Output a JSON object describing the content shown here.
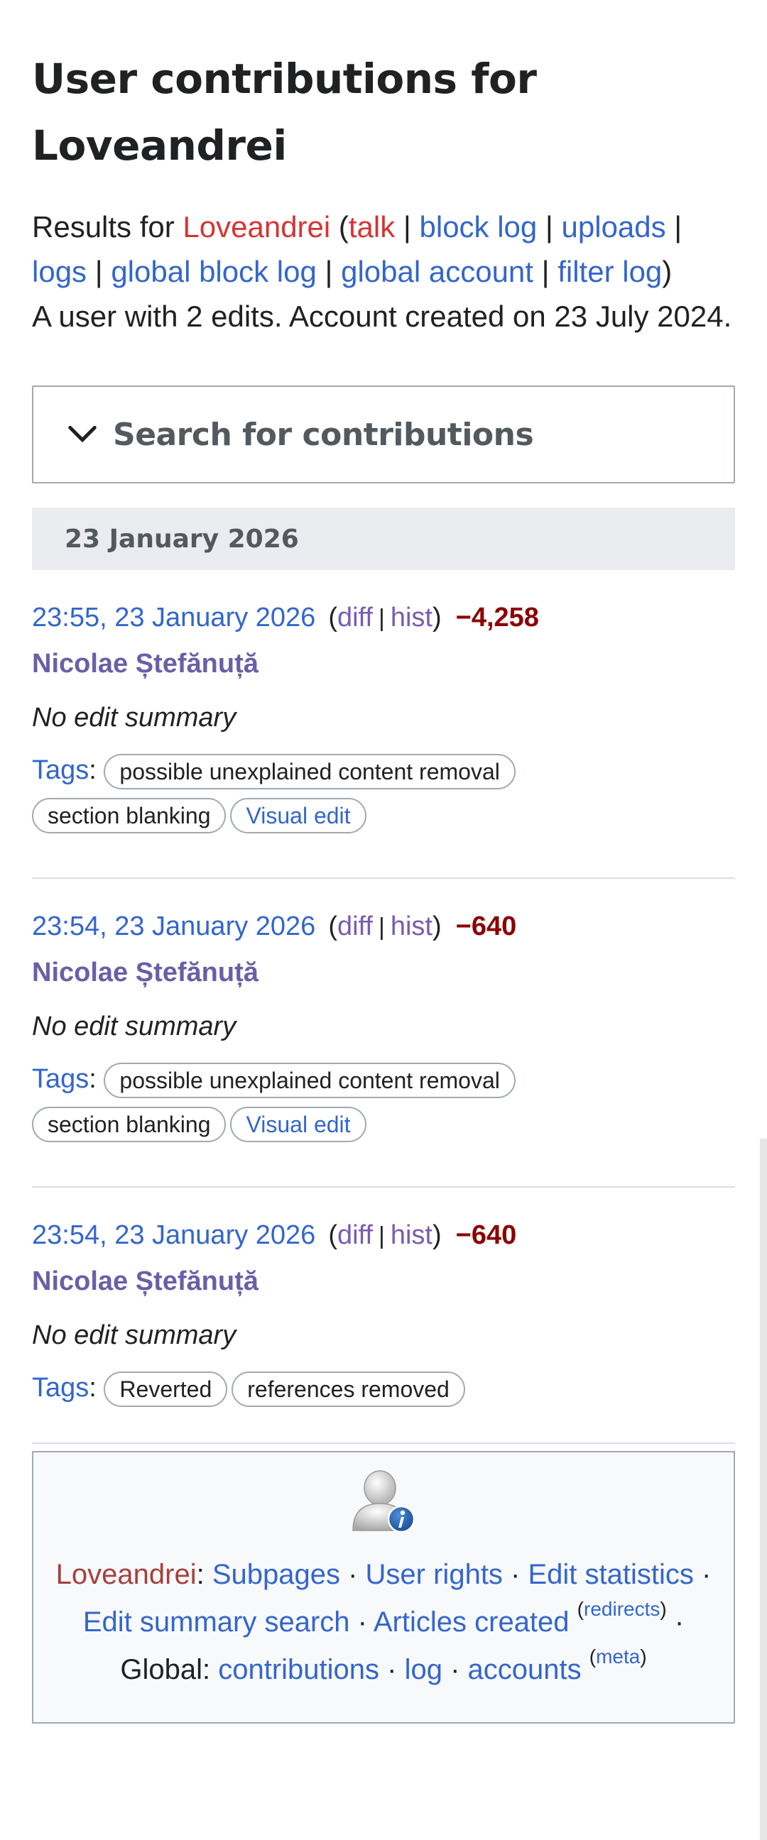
{
  "page": {
    "title_line1": "User contributions for",
    "title_line2": "Loveandrei"
  },
  "results": {
    "prefix": "Results for ",
    "username": "Loveandrei",
    "links": [
      "talk",
      "block log",
      "uploads",
      "logs",
      "global block log",
      "global account",
      "filter log"
    ],
    "summary": "A user with 2 edits. Account created on 23 July 2024."
  },
  "search": {
    "label": "Search for contributions",
    "icon": "chevron-down-icon"
  },
  "date_header": "23 January 2026",
  "entries": [
    {
      "timestamp": "23:55, 23 January 2026",
      "diff": "diff",
      "hist": "hist",
      "size": "−4,258",
      "page": "Nicolae Ștefănuță",
      "summary": "No edit summary",
      "tags_label": "Tags",
      "tags": [
        "possible unexplained content removal",
        "section blanking",
        "Visual edit"
      ]
    },
    {
      "timestamp": "23:54, 23 January 2026",
      "diff": "diff",
      "hist": "hist",
      "size": "−640",
      "page": "Nicolae Ștefănuță",
      "summary": "No edit summary",
      "tags_label": "Tags",
      "tags": [
        "possible unexplained content removal",
        "section blanking",
        "Visual edit"
      ]
    },
    {
      "timestamp": "23:54, 23 January 2026",
      "diff": "diff",
      "hist": "hist",
      "size": "−640",
      "page": "Nicolae Ștefănuță",
      "summary": "No edit summary",
      "tags_label": "Tags",
      "tags": [
        "Reverted",
        "references removed"
      ]
    }
  ],
  "footer": {
    "icon": "user-info-icon",
    "username": "Loveandrei",
    "subpages": "Subpages",
    "user_rights": "User rights",
    "edit_statistics": "Edit statistics",
    "edit_summary_search": "Edit summary search",
    "articles_created": "Articles created",
    "redirects": "redirects",
    "global_label": "Global:",
    "contributions": "contributions",
    "log": "log",
    "accounts": "accounts",
    "meta": "meta"
  },
  "colors": {
    "link": "#3366cc",
    "redlink": "#d73333",
    "visited": "#795cb2",
    "negative_size": "#8b0000"
  }
}
